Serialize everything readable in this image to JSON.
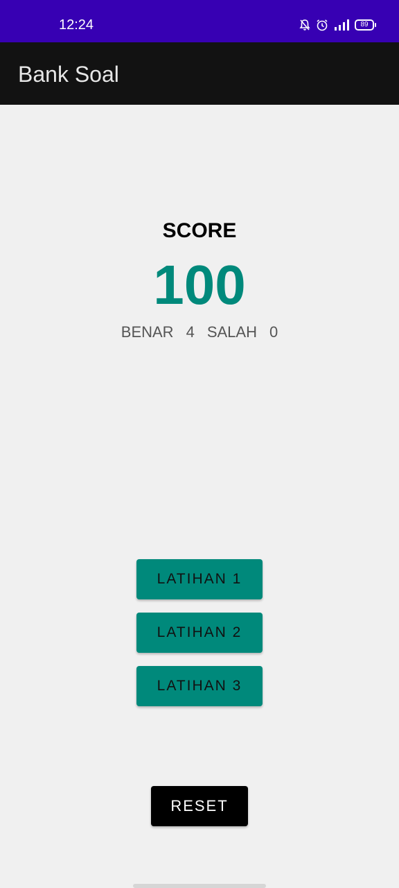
{
  "status_bar": {
    "time": "12:24",
    "battery": "89",
    "icons": [
      "notifications-off-icon",
      "alarm-icon",
      "signal-icon",
      "battery-icon"
    ]
  },
  "app_bar": {
    "title": "Bank Soal"
  },
  "score": {
    "label": "SCORE",
    "value": "100",
    "correct_label": "BENAR",
    "correct_value": "4",
    "wrong_label": "SALAH",
    "wrong_value": "0"
  },
  "buttons": {
    "latihan_1": "LATIHAN 1",
    "latihan_2": "LATIHAN 2",
    "latihan_3": "LATIHAN 3",
    "reset": "RESET"
  },
  "colors": {
    "status_bar": "#3700b3",
    "app_bar": "#121212",
    "accent": "#00897b",
    "background": "#f0f0f0"
  }
}
